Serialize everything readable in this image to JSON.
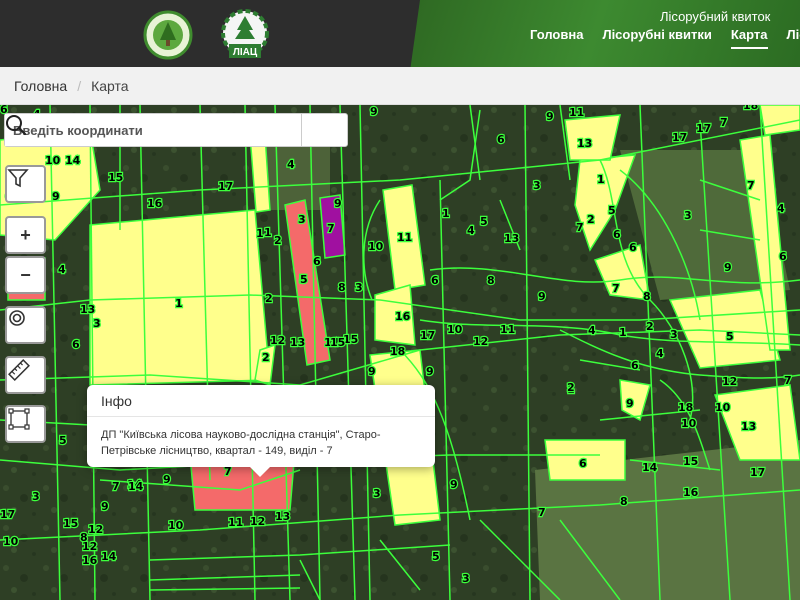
{
  "header": {
    "site_title": "Лісорубний квиток",
    "logo_left": "forest-emblem-logo",
    "logo_right": "liac-logo",
    "logo_right_text": "ЛІАЦ",
    "nav": [
      {
        "label": "Головна",
        "active": false
      },
      {
        "label": "Лісорубні квитки",
        "active": false
      },
      {
        "label": "Карта",
        "active": true
      },
      {
        "label": "Лісові",
        "active": false
      }
    ]
  },
  "breadcrumb": {
    "home": "Головна",
    "current": "Карта"
  },
  "search": {
    "placeholder": "Введіть координати",
    "icon": "search-icon"
  },
  "tools": {
    "filter": "filter-icon",
    "zoom_in": "+",
    "zoom_out": "−",
    "locate": "target-icon",
    "measure": "ruler-icon",
    "select": "bounding-box-icon"
  },
  "popup": {
    "title": "Інфо",
    "text": "ДП \"Київська лісова науково-дослідна станція\", Старо-Петрівське лісництво, квартал - 149, виділ - 7"
  },
  "colors": {
    "yellow_parcel": "#ffff8c",
    "red_parcel": "#f46a6a",
    "purple_parcel": "#a010a0",
    "boundary": "#3cff3c"
  },
  "labels": {
    "l1": "6",
    "l2": "4",
    "l3": "10",
    "l4": "14",
    "l5": "6",
    "l6": "15",
    "l7": "17",
    "l8": "16",
    "l9": "4",
    "l10": "9",
    "l11": "1",
    "l12": "1",
    "l13": "2",
    "l14": "3",
    "l15": "5",
    "l16": "7",
    "l17": "9",
    "l18": "10",
    "l19": "11",
    "l20": "6",
    "l21": "8",
    "l22": "1",
    "l23": "13",
    "l24": "3",
    "l25": "6",
    "l26": "12",
    "l27": "13",
    "l28": "14",
    "l29": "15",
    "l30": "2",
    "l31": "5",
    "l32": "3",
    "l33": "2",
    "l34": "1",
    "l35": "3",
    "l36": "4",
    "l37": "5",
    "l38": "13",
    "l39": "8",
    "l40": "9",
    "l41": "16",
    "l42": "18",
    "l43": "17",
    "l44": "10",
    "l45": "11",
    "l46": "12",
    "l47": "4",
    "l48": "1",
    "l49": "2",
    "l50": "5",
    "l51": "3",
    "l52": "7",
    "l53": "6",
    "l54": "7",
    "l55": "1",
    "l56": "2",
    "l57": "5",
    "l58": "3",
    "l59": "9",
    "l60": "7",
    "l61": "8",
    "l62": "6",
    "l63": "4",
    "l64": "12",
    "l65": "9",
    "l66": "10",
    "l67": "18",
    "l68": "10",
    "l69": "15",
    "l70": "13",
    "l71": "14",
    "l72": "6",
    "l73": "17",
    "l74": "16",
    "l75": "8",
    "l76": "7",
    "l77": "9",
    "l78": "3",
    "l79": "6",
    "l80": "12",
    "l81": "13",
    "l82": "11",
    "l83": "10",
    "l84": "12",
    "l85": "5",
    "l86": "7",
    "l87": "3",
    "l88": "15",
    "l89": "14",
    "l90": "4",
    "l91": "8",
    "l92": "17",
    "l93": "16",
    "l94": "9",
    "l95": "7",
    "l96": "9",
    "l97": "6",
    "l98": "9",
    "l99": "13",
    "l100": "17",
    "l101": "14",
    "l102": "9",
    "l103": "3",
    "l104": "5",
    "l105": "17",
    "l106": "18",
    "l107": "7",
    "l108": "10",
    "l109": "14",
    "l110": "9",
    "l111": "15",
    "l112": "12",
    "l113": "11",
    "l114": "9",
    "l115": "6",
    "l116": "4",
    "l117": "6",
    "l118": "7",
    "l119": "1",
    "l120": "2"
  }
}
